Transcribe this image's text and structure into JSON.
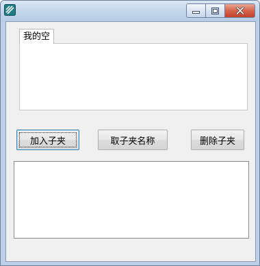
{
  "window": {
    "title": "",
    "app_icon": "app-icon",
    "caption_buttons": [
      "minimize-icon",
      "maximize-icon",
      "close-icon"
    ]
  },
  "tabs": [
    {
      "label": "我的空"
    }
  ],
  "buttons": {
    "add_subfolder": "加入子夹",
    "get_subfolder_name": "取子夹名称",
    "delete_subfolder": "删除子夹"
  },
  "colors": {
    "titlebar": "#c4d6ec",
    "close_button": "#c9452e",
    "client_background": "#f0f0f0"
  }
}
